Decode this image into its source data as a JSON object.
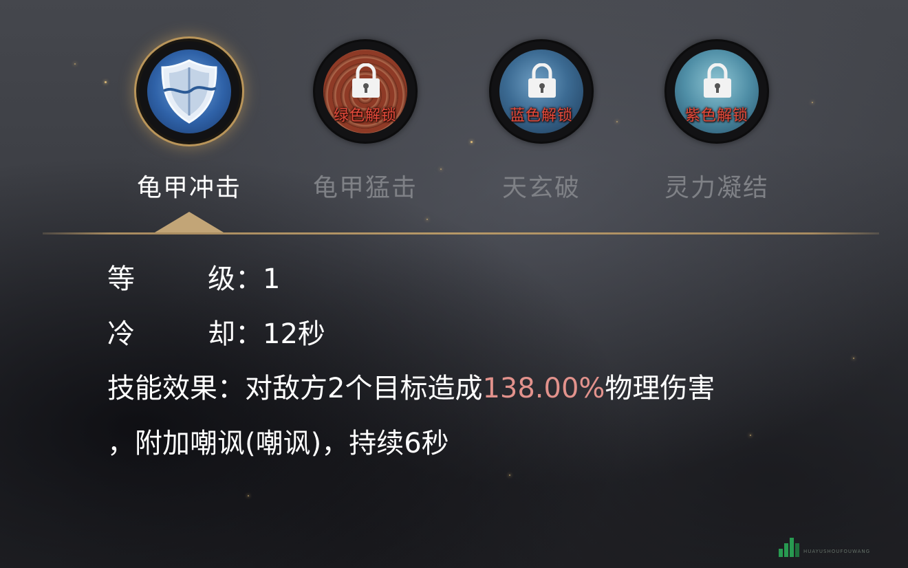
{
  "skills": [
    {
      "name": "龟甲冲击",
      "selected": true,
      "locked": false
    },
    {
      "name": "龟甲猛击",
      "selected": false,
      "locked": true,
      "unlock_text": "绿色解锁"
    },
    {
      "name": "天玄破",
      "selected": false,
      "locked": true,
      "unlock_text": "蓝色解锁"
    },
    {
      "name": "灵力凝结",
      "selected": false,
      "locked": true,
      "unlock_text": "紫色解锁"
    }
  ],
  "details": {
    "level_label_a": "等",
    "level_label_b": "级：",
    "level_value": "1",
    "cooldown_label_a": "冷",
    "cooldown_label_b": "却：",
    "cooldown_value": "12秒",
    "effect_label": "技能效果：",
    "effect_before": "对敌方2个目标造成",
    "effect_highlight": "138.00%",
    "effect_after": "物理伤害",
    "effect_line2": "，附加嘲讽(嘲讽)，持续6秒"
  },
  "watermark_text": "HUAYUSHOUFOUWANG",
  "colors": {
    "highlight": "#e2928c",
    "locked_label": "#e24a3b",
    "accent_gold": "#c2a577"
  }
}
